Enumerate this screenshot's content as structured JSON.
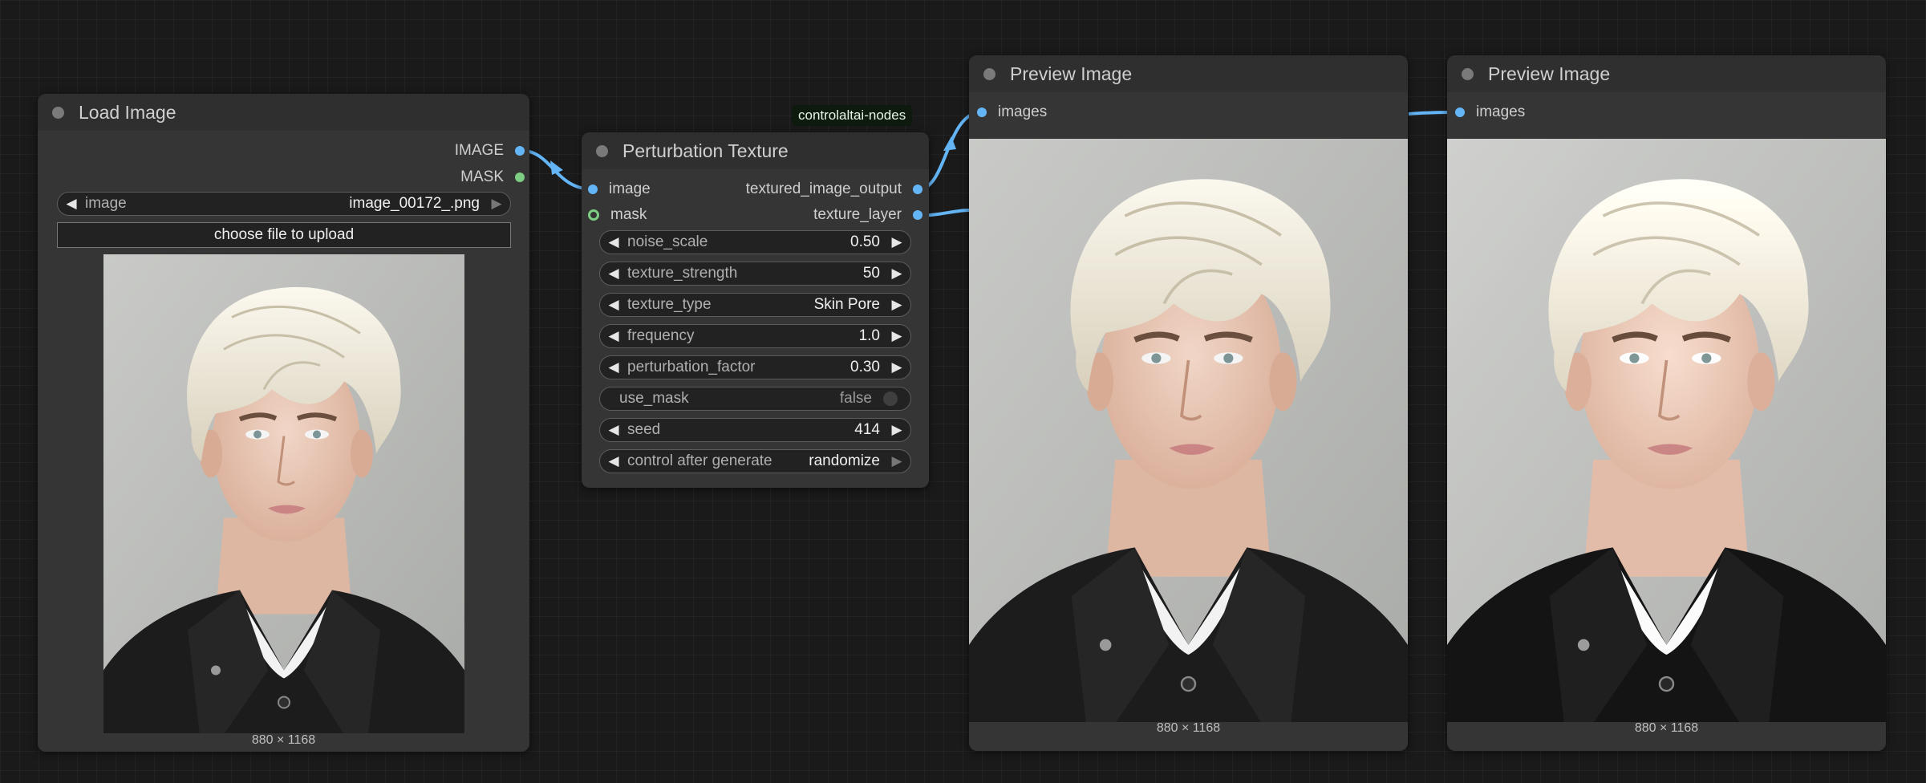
{
  "badge": "controlaltai-nodes",
  "load_image": {
    "title": "Load Image",
    "outputs": [
      "IMAGE",
      "MASK"
    ],
    "image_widget": {
      "label": "image",
      "value": "image_00172_.png"
    },
    "upload_label": "choose file to upload",
    "size": "880 × 1168"
  },
  "perturbation": {
    "title": "Perturbation Texture",
    "inputs": [
      "image",
      "mask"
    ],
    "outputs": [
      "textured_image_output",
      "texture_layer"
    ],
    "widgets": [
      {
        "label": "noise_scale",
        "value": "0.50"
      },
      {
        "label": "texture_strength",
        "value": "50"
      },
      {
        "label": "texture_type",
        "value": "Skin Pore"
      },
      {
        "label": "frequency",
        "value": "1.0"
      },
      {
        "label": "perturbation_factor",
        "value": "0.30"
      },
      {
        "label": "use_mask",
        "value": "false"
      },
      {
        "label": "seed",
        "value": "414"
      },
      {
        "label": "control after generate",
        "value": "randomize"
      }
    ]
  },
  "preview_1": {
    "title": "Preview Image",
    "input": "images",
    "size": "880 × 1168"
  },
  "preview_2": {
    "title": "Preview Image",
    "input": "images",
    "size": "880 × 1168"
  },
  "colors": {
    "image_link": "#64b5f6",
    "mask_slot": "#7ccf82",
    "canvas": "#1a1a1a",
    "node": "#353535"
  }
}
